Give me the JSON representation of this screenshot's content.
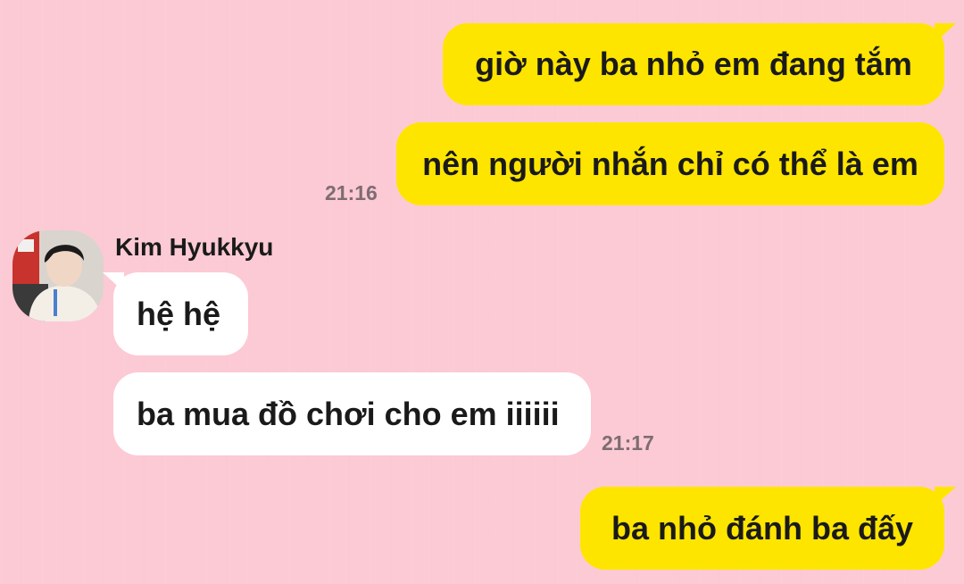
{
  "chat": {
    "messages": [
      {
        "direction": "outgoing",
        "text": "giờ này ba nhỏ em đang tắm"
      },
      {
        "direction": "outgoing",
        "text": "nên người nhắn chỉ có thể là em",
        "time": "21:16"
      },
      {
        "direction": "incoming",
        "sender": "Kim Hyukkyu",
        "text": "hệ hệ"
      },
      {
        "direction": "incoming",
        "text": "ba mua đồ chơi cho em iiiiii",
        "time": "21:17"
      },
      {
        "direction": "outgoing",
        "text": "ba nhỏ đánh ba đấy"
      }
    ]
  },
  "colors": {
    "background": "#fccad4",
    "outgoing_bubble": "#fee500",
    "incoming_bubble": "#ffffff",
    "timestamp": "#7d6d72"
  },
  "icons": {
    "avatar": "profile-photo"
  }
}
